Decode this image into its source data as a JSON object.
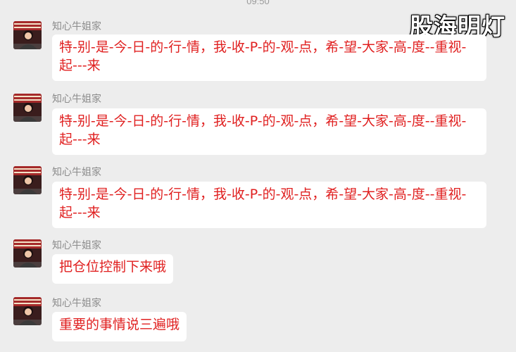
{
  "status": {
    "time": "09:50"
  },
  "watermark": {
    "text": "股海明灯"
  },
  "messages": [
    {
      "sender": "知心牛姐家",
      "text": "特-别-是-今-日-的-行-情，我-收-P-的-观-点，希-望-大家-高-度--重视-起---来"
    },
    {
      "sender": "知心牛姐家",
      "text": "特-别-是-今-日-的-行-情，我-收-P-的-观-点，希-望-大家-高-度--重视-起---来"
    },
    {
      "sender": "知心牛姐家",
      "text": "特-别-是-今-日-的-行-情，我-收-P-的-观-点，希-望-大家-高-度--重视-起---来"
    },
    {
      "sender": "知心牛姐家",
      "text": "把仓位控制下来哦"
    },
    {
      "sender": "知心牛姐家",
      "text": "重要的事情说三遍哦"
    }
  ],
  "colors": {
    "background": "#ededed",
    "bubble": "#ffffff",
    "message_text": "#e02020",
    "sender_text": "#8c8c8c"
  }
}
